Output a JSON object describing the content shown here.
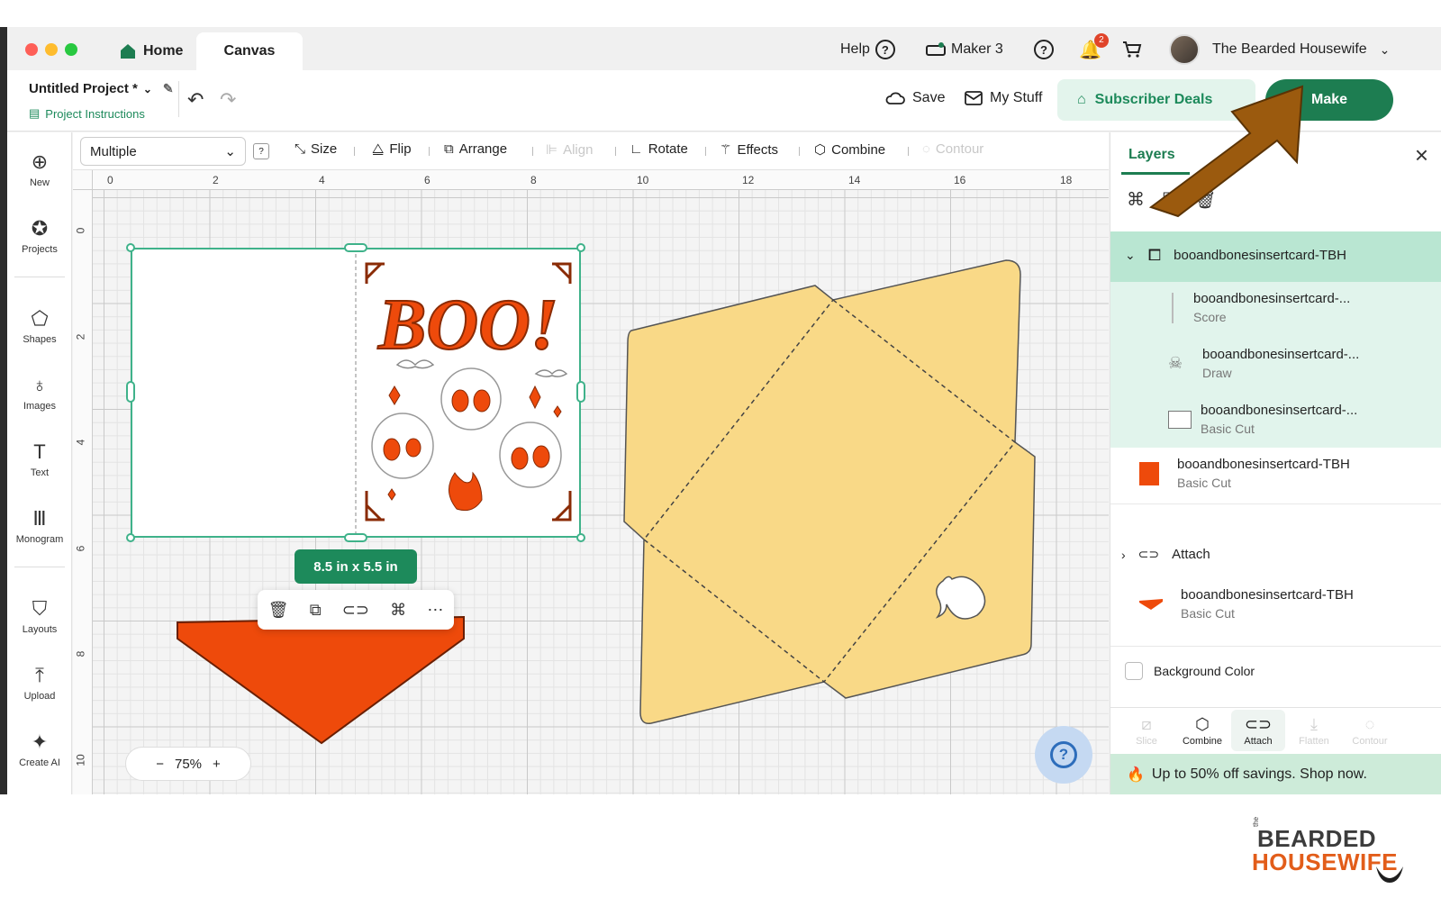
{
  "window": {
    "tabs": [
      {
        "label": "Home"
      },
      {
        "label": "Canvas"
      }
    ],
    "top_right": {
      "help_label": "Help",
      "machine_label": "Maker 3",
      "notifications_count": "2",
      "user_name": "The Bearded Housewife"
    }
  },
  "project": {
    "title": "Untitled Project *",
    "instructions_label": "Project Instructions",
    "save_label": "Save",
    "my_stuff_label": "My Stuff",
    "subscriber_deals_label": "Subscriber Deals",
    "make_label": "Make"
  },
  "left_tools": [
    {
      "label": "New",
      "icon": "plus-circle-icon"
    },
    {
      "label": "Projects",
      "icon": "rocket-icon"
    },
    {
      "label": "Shapes",
      "icon": "shapes-icon"
    },
    {
      "label": "Images",
      "icon": "lightbulb-icon"
    },
    {
      "label": "Text",
      "icon": "text-icon"
    },
    {
      "label": "Monogram",
      "icon": "monogram-icon"
    },
    {
      "label": "Layouts",
      "icon": "tshirt-icon"
    },
    {
      "label": "Upload",
      "icon": "upload-icon"
    },
    {
      "label": "Create AI",
      "icon": "sparkle-icon"
    }
  ],
  "edit_toolbar": {
    "selection_value": "Multiple",
    "size_label": "Size",
    "flip_label": "Flip",
    "arrange_label": "Arrange",
    "align_label": "Align",
    "rotate_label": "Rotate",
    "effects_label": "Effects",
    "combine_label": "Combine",
    "contour_label": "Contour"
  },
  "rulers": {
    "top": [
      "0",
      "2",
      "4",
      "6",
      "8",
      "10",
      "12",
      "14",
      "16",
      "18"
    ],
    "left": [
      "0",
      "2",
      "4",
      "6",
      "8",
      "10"
    ]
  },
  "canvas": {
    "card_text": "BOO!",
    "size_label": "8.5  in x 5.5  in",
    "zoom_label": "75%",
    "zoom_minus": "−",
    "zoom_plus": "+"
  },
  "layers_panel": {
    "tab_label": "Layers",
    "group_name": "booandbonesinsertcard-TBH",
    "layers": [
      {
        "name": "booandbonesinsertcard-...",
        "op": "Score"
      },
      {
        "name": "booandbonesinsertcard-...",
        "op": "Draw"
      },
      {
        "name": "booandbonesinsertcard-...",
        "op": "Basic Cut"
      },
      {
        "name": "booandbonesinsertcard-TBH",
        "op": "Basic Cut",
        "color": "#ee4a0b"
      },
      {
        "name": "Attach"
      },
      {
        "name": "booandbonesinsertcard-TBH",
        "op": "Basic Cut",
        "color": "#ee4a0b"
      }
    ],
    "background_color_label": "Background Color",
    "bottom_tools": [
      {
        "label": "Slice",
        "enabled": false
      },
      {
        "label": "Combine",
        "enabled": true
      },
      {
        "label": "Attach",
        "enabled": true
      },
      {
        "label": "Flatten",
        "enabled": false
      },
      {
        "label": "Contour",
        "enabled": false
      }
    ],
    "promo_text": "Up to 50% off savings. Shop now."
  },
  "watermark": {
    "small": "the",
    "line1": "BEARDED",
    "line2": "HOUSEWIFE"
  },
  "colors": {
    "accent_green": "#1d7d51",
    "orange": "#ee4a0b",
    "envelope": "#f9d987",
    "arrow": "#9b5a0e"
  }
}
